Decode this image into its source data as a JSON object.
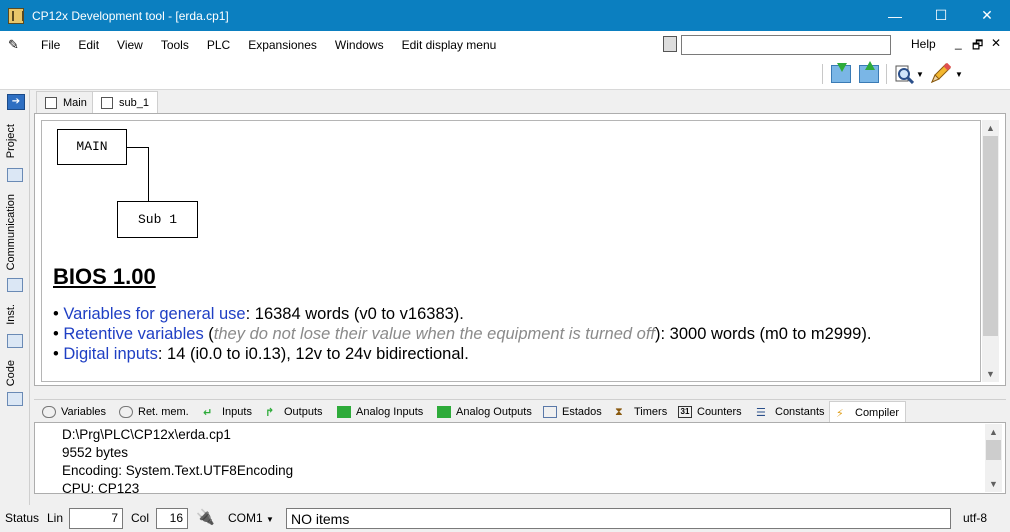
{
  "window": {
    "title": "CP12x Development tool - [erda.cp1]",
    "minimize_glyph": "—",
    "maximize_glyph": "☐",
    "close_glyph": "✕"
  },
  "menu": {
    "items": [
      "File",
      "Edit",
      "View",
      "Tools",
      "PLC",
      "Expansiones",
      "Windows",
      "Edit display menu"
    ],
    "search_value": "",
    "help": "Help",
    "minimize_glyph": "_",
    "restore_glyph": "🗗",
    "close_glyph": "✕"
  },
  "sidebar": {
    "tabs": [
      "Project",
      "Communication",
      "Inst.",
      "Code"
    ]
  },
  "doc_tabs": [
    "Main",
    "sub_1"
  ],
  "diagram": {
    "main_node": "MAIN",
    "sub_node": "Sub 1"
  },
  "bios": {
    "title": "BIOS 1.00",
    "items": [
      {
        "label": "Variables for general use",
        "pre": "",
        "note": "",
        "text": ": 16384 words (v0 to v16383)."
      },
      {
        "label": "Retentive variables",
        "pre": " (",
        "note": "they do not lose their value when the equipment is turned off",
        "text": "): 3000 words (m0 to m2999)."
      },
      {
        "label": "Digital inputs",
        "pre": "",
        "note": "",
        "text": ": 14 (i0.0 to i0.13), 12v to 24v bidirectional."
      }
    ]
  },
  "bottom_tabs": [
    "Variables",
    "Ret. mem.",
    "Inputs",
    "Outputs",
    "Analog Inputs",
    "Analog Outputs",
    "Estados",
    "Timers",
    "Counters",
    "Constants",
    "Compiler"
  ],
  "output": {
    "lines": [
      "D:\\Prg\\PLC\\CP12x\\erda.cp1",
      "9552 bytes",
      "Encoding: System.Text.UTF8Encoding",
      "CPU: CP123"
    ]
  },
  "status": {
    "label": "Status",
    "lin_label": "Lin",
    "lin_value": "7",
    "col_label": "Col",
    "col_value": "16",
    "port": "COM1",
    "message": "NO items",
    "encoding": "utf-8"
  },
  "colors": {
    "titlebar": "#0b7fc0",
    "link_blue": "#1f3fc4",
    "note_gray": "#8a8a8a"
  }
}
